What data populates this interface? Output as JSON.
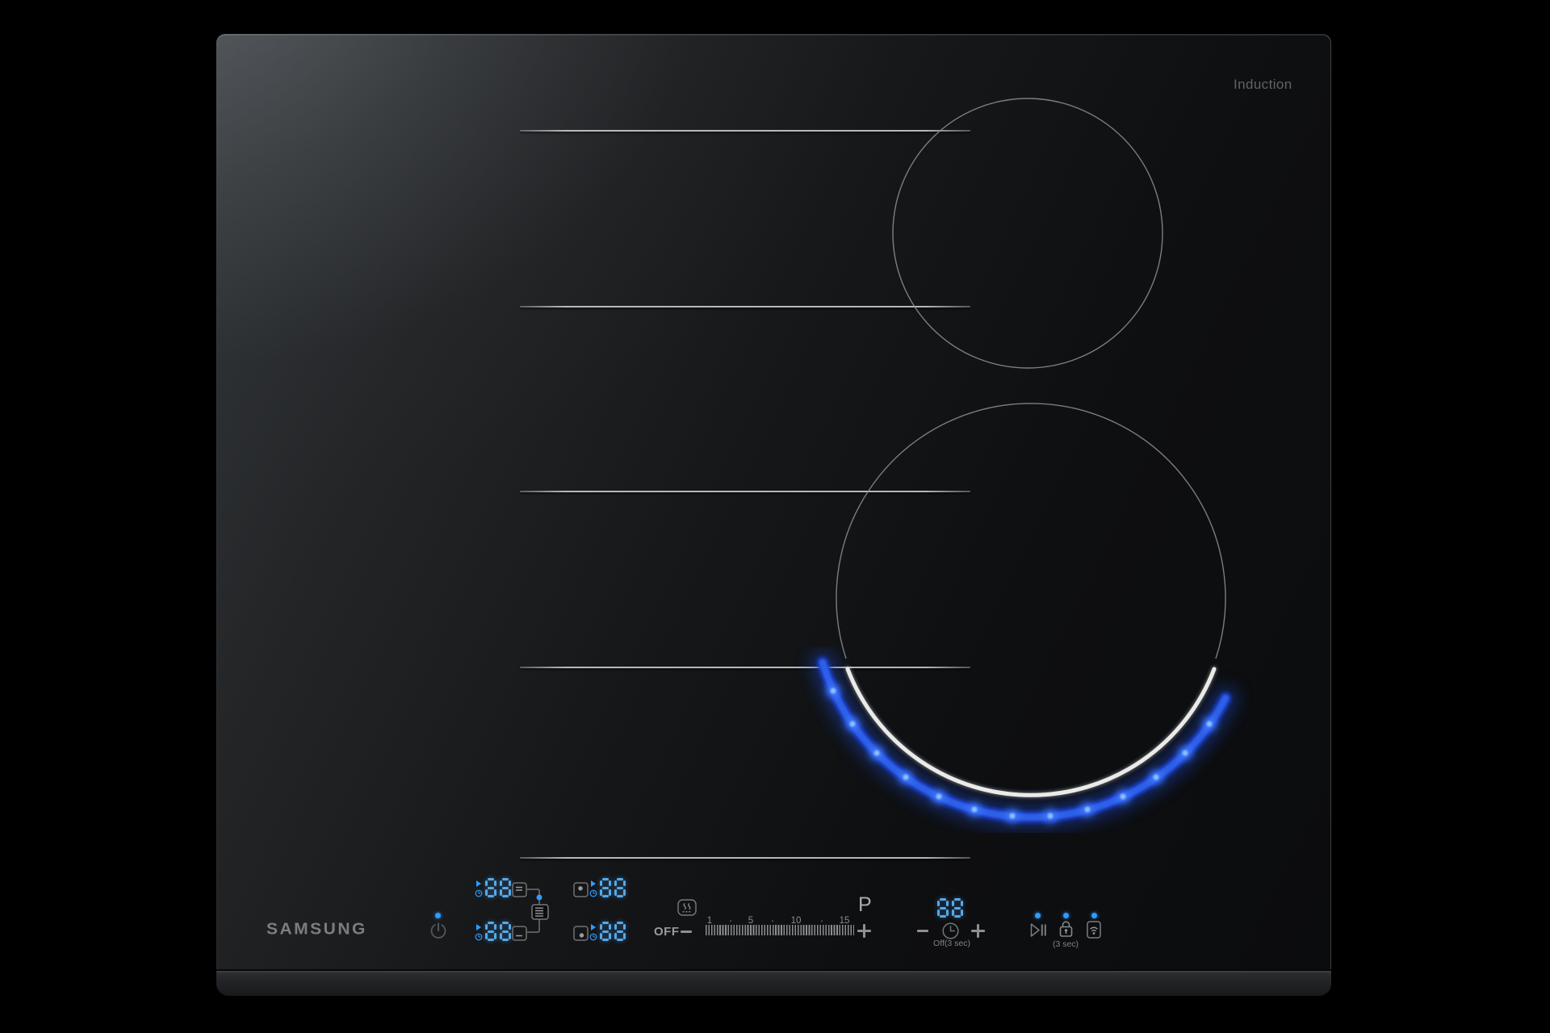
{
  "cooktop": {
    "brand_logo": "SAMSUNG",
    "type_label": "Induction"
  },
  "burners": {
    "left_flex_zone_lines": 5,
    "right_rear": {
      "shape": "circle",
      "state": "off"
    },
    "right_front": {
      "shape": "circle",
      "state": "active",
      "glow": "blue LED arc"
    }
  },
  "controls": {
    "power": {
      "indicator_dot": true,
      "icon": "power-icon"
    },
    "zone_keys": [
      {
        "id": "left-rear",
        "display": "88",
        "icons": [
          "timer-play-indicator",
          "mini-clock-icon",
          "zone-rect-rear-icon"
        ]
      },
      {
        "id": "left-front",
        "display": "88",
        "icons": [
          "timer-play-indicator",
          "mini-clock-icon",
          "zone-rect-front-icon"
        ]
      },
      {
        "id": "right-rear",
        "display": "88",
        "icons": [
          "zone-dot-rear-icon",
          "timer-play-indicator",
          "mini-clock-icon"
        ]
      },
      {
        "id": "right-front",
        "display": "88",
        "icons": [
          "zone-dot-front-icon",
          "timer-play-indicator",
          "mini-clock-icon"
        ]
      }
    ],
    "flex_link": {
      "icon": "flex-zone-link-icon",
      "indicator_dot": true
    },
    "slider": {
      "off_label": "OFF",
      "minus": "−",
      "plus": "+",
      "scale_labels": [
        "1",
        "5",
        "10",
        "15"
      ],
      "dot_separator": "·",
      "power_boost_label": "P",
      "keep_warm_icon": "keep-warm-icon"
    },
    "timer": {
      "display": "88",
      "minus": "−",
      "plus": "+",
      "clock_icon": "timer-clock-icon",
      "hold_label": "Off(3 sec)"
    },
    "right_keys": {
      "pause_resume": {
        "icon": "pause-resume-icon",
        "indicator_dot": true
      },
      "lock": {
        "icon": "lock-icon",
        "indicator_dot": true,
        "hold_label": "(3 sec)"
      },
      "smart_control": {
        "icon": "smart-connect-icon",
        "indicator_dot": true
      }
    }
  },
  "colors": {
    "background": "#000000",
    "led_blue": "#55AAE8",
    "indicator_blue": "#2F9BFF",
    "glow_blue": "#2B5CE8",
    "burner_ring_gray": "#8E9092",
    "white_arc": "#EAEAE8",
    "icon_gray": "#77797b",
    "text_gray": "#969698",
    "logo_gray": "#7d7d7d"
  }
}
